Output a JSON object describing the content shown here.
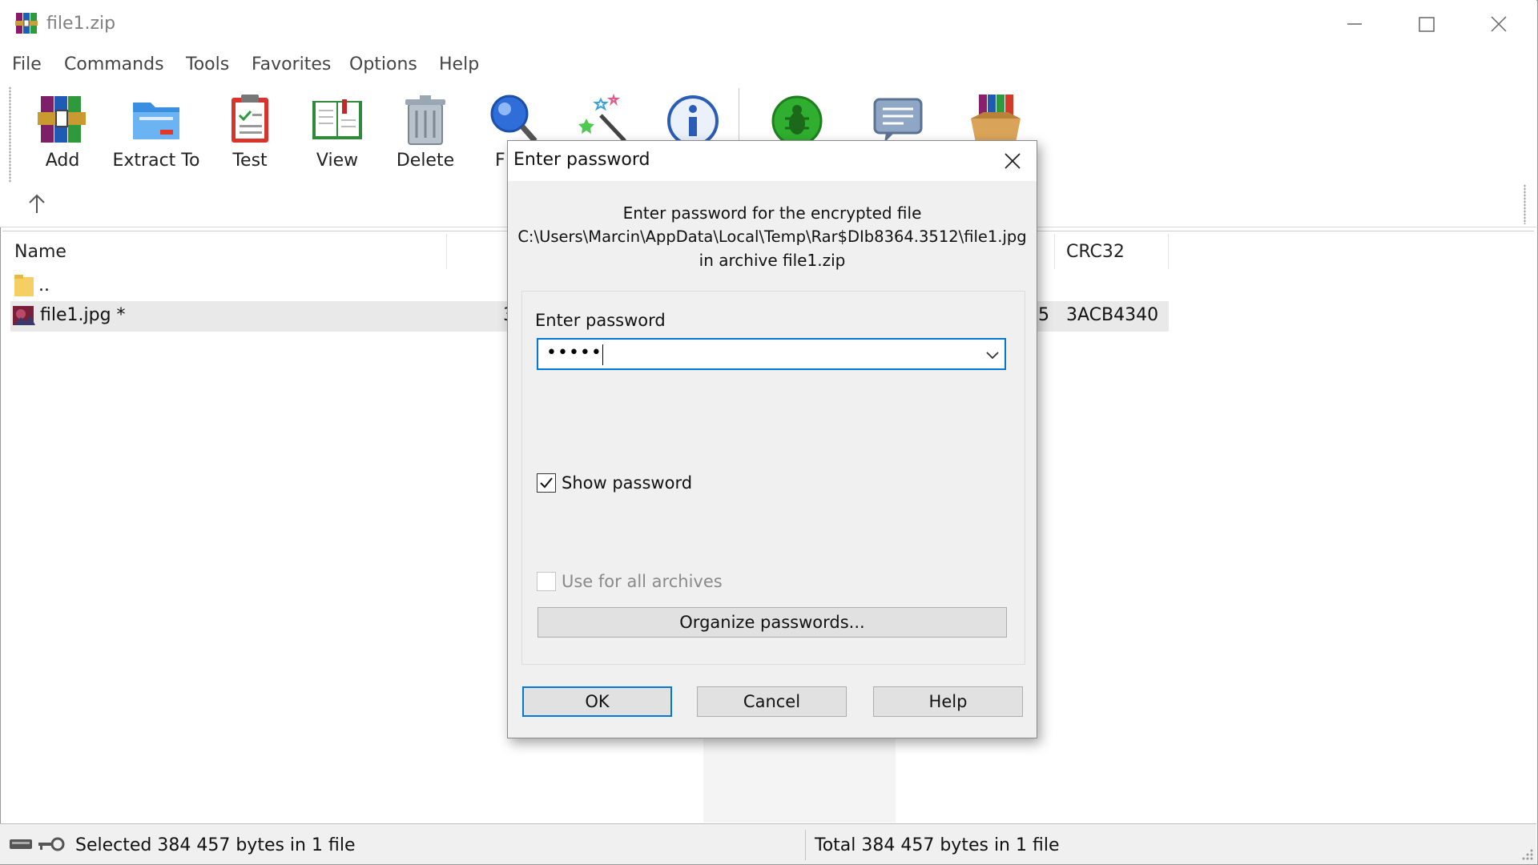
{
  "window": {
    "title": "file1.zip"
  },
  "menu": [
    "File",
    "Commands",
    "Tools",
    "Favorites",
    "Options",
    "Help"
  ],
  "toolbar": {
    "add": "Add",
    "extract_to": "Extract To",
    "test": "Test",
    "view": "View",
    "delete": "Delete",
    "find_partial": "F"
  },
  "file_list": {
    "columns": {
      "name": "Name",
      "crc32": "CRC32"
    },
    "rows": [
      {
        "name": "..",
        "crc32": ""
      },
      {
        "name": "file1.jpg *",
        "partial_left": "3",
        "partial_right": "5",
        "crc32": "3ACB4340"
      }
    ]
  },
  "status": {
    "left": "Selected 384 457 bytes in 1 file",
    "right": "Total 384 457 bytes in 1 file"
  },
  "dialog": {
    "title": "Enter password",
    "message_line1": "Enter password for the encrypted file",
    "message_line2": "C:\\Users\\Marcin\\AppData\\Local\\Temp\\Rar$DIb8364.3512\\file1.jpg",
    "message_line3": "in archive file1.zip",
    "password_label": "Enter password",
    "password_value": "•••••",
    "show_password_label": "Show password",
    "show_password_checked": true,
    "use_for_all_label": "Use for all archives",
    "use_for_all_checked": false,
    "organize_button": "Organize passwords...",
    "ok_button": "OK",
    "cancel_button": "Cancel",
    "help_button": "Help"
  },
  "colors": {
    "accent": "#0078d7",
    "dialog_bg": "#f0f0f0",
    "selected_row": "#e9e9e9"
  }
}
